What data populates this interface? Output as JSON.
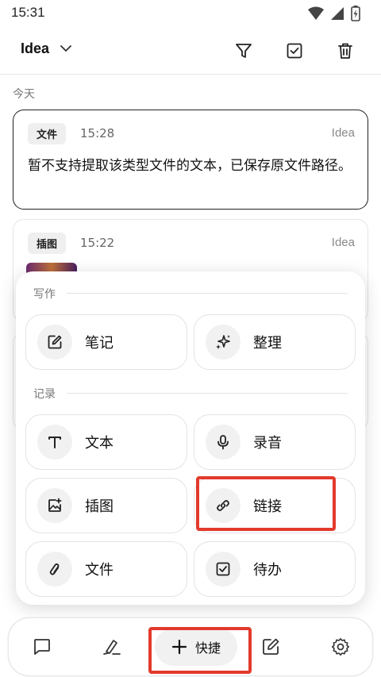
{
  "status": {
    "time": "15:31"
  },
  "header": {
    "title": "Idea"
  },
  "section": {
    "today": "今天"
  },
  "cards": [
    {
      "tag": "文件",
      "time": "15:28",
      "source": "Idea",
      "text": "暂不支持提取该类型文件的文本，已保存原文件路径。"
    },
    {
      "tag": "插图",
      "time": "15:22",
      "source": "Idea"
    }
  ],
  "quick_panel": {
    "write_group": "写作",
    "record_group": "记录",
    "write_items": [
      {
        "label": "笔记",
        "icon": "edit-note-icon"
      },
      {
        "label": "整理",
        "icon": "sparkle-icon"
      }
    ],
    "record_items": [
      {
        "label": "文本",
        "icon": "text-icon"
      },
      {
        "label": "录音",
        "icon": "mic-icon"
      },
      {
        "label": "插图",
        "icon": "image-add-icon"
      },
      {
        "label": "链接",
        "icon": "link-icon"
      },
      {
        "label": "文件",
        "icon": "paperclip-icon"
      },
      {
        "label": "待办",
        "icon": "checkbox-icon"
      }
    ]
  },
  "nav": {
    "quick_label": "快捷"
  },
  "colors": {
    "highlight": "#e23a2c",
    "text": "#111111",
    "muted": "#777777"
  }
}
